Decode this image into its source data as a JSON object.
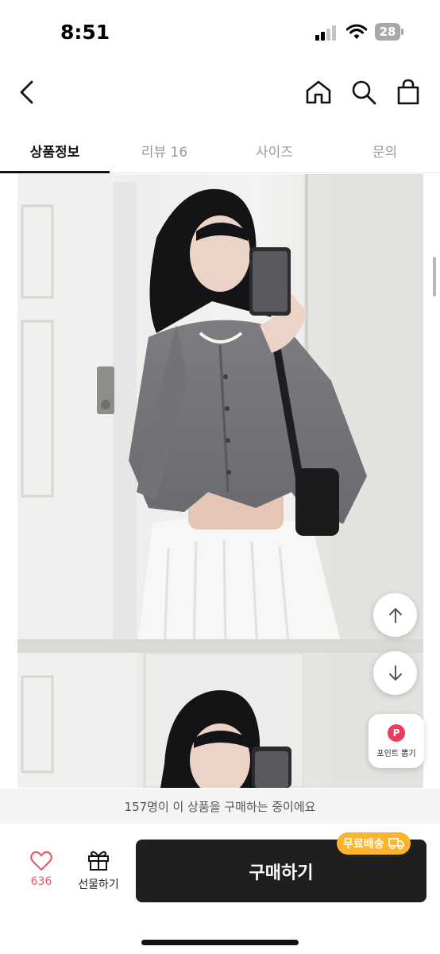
{
  "status_bar": {
    "time": "8:51",
    "battery_level": "28"
  },
  "header": {
    "back_icon": "chevron-left-icon",
    "home_icon": "home-icon",
    "search_icon": "search-icon",
    "cart_icon": "shopping-bag-icon"
  },
  "tabs": [
    {
      "label": "상품정보",
      "active": true
    },
    {
      "label": "리뷰 16",
      "active": false
    },
    {
      "label": "사이즈",
      "active": false
    },
    {
      "label": "문의",
      "active": false
    }
  ],
  "floating": {
    "scroll_up_icon": "arrow-up-icon",
    "scroll_down_icon": "arrow-down-icon",
    "point_badge": "P",
    "point_label": "포인트 뽑기"
  },
  "purchase_banner": {
    "text": "157명이 이 상품을 구매하는 중이에요"
  },
  "bottom_bar": {
    "like_count": "636",
    "gift_label": "선물하기",
    "buy_label": "구매하기",
    "shipping_badge": "무료배송"
  },
  "colors": {
    "accent_pink": "#ee3b5b",
    "like_pink": "#e85a6a",
    "buy_button": "#1f1f1f",
    "shipping_badge": "#fbb52c"
  }
}
